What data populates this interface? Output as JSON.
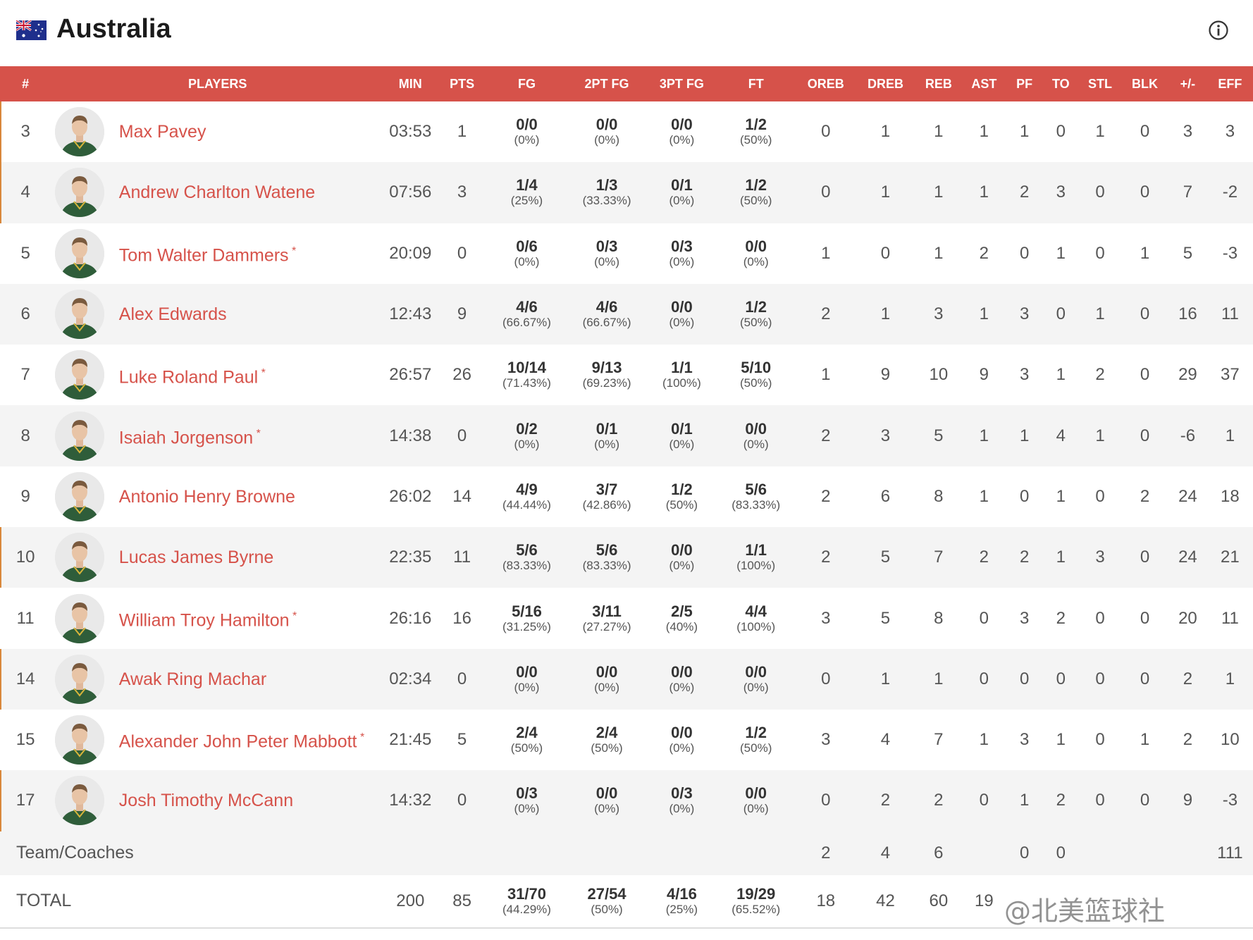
{
  "team": {
    "name": "Australia"
  },
  "columns": [
    "#",
    "PLAYERS",
    "MIN",
    "PTS",
    "FG",
    "2PT FG",
    "3PT FG",
    "FT",
    "OREB",
    "DREB",
    "REB",
    "AST",
    "PF",
    "TO",
    "STL",
    "BLK",
    "+/-",
    "EFF"
  ],
  "players": [
    {
      "no": "3",
      "name": "Max Pavey",
      "starter": false,
      "min": "03:53",
      "pts": "1",
      "fg": "0/0",
      "fg_pct": "(0%)",
      "fg2": "0/0",
      "fg2_pct": "(0%)",
      "fg3": "0/0",
      "fg3_pct": "(0%)",
      "ft": "1/2",
      "ft_pct": "(50%)",
      "oreb": "0",
      "dreb": "1",
      "reb": "1",
      "ast": "1",
      "pf": "1",
      "to": "0",
      "stl": "1",
      "blk": "0",
      "pm": "3",
      "eff": "3"
    },
    {
      "no": "4",
      "name": "Andrew Charlton Watene",
      "starter": false,
      "min": "07:56",
      "pts": "3",
      "fg": "1/4",
      "fg_pct": "(25%)",
      "fg2": "1/3",
      "fg2_pct": "(33.33%)",
      "fg3": "0/1",
      "fg3_pct": "(0%)",
      "ft": "1/2",
      "ft_pct": "(50%)",
      "oreb": "0",
      "dreb": "1",
      "reb": "1",
      "ast": "1",
      "pf": "2",
      "to": "3",
      "stl": "0",
      "blk": "0",
      "pm": "7",
      "eff": "-2"
    },
    {
      "no": "5",
      "name": "Tom Walter Dammers",
      "starter": true,
      "min": "20:09",
      "pts": "0",
      "fg": "0/6",
      "fg_pct": "(0%)",
      "fg2": "0/3",
      "fg2_pct": "(0%)",
      "fg3": "0/3",
      "fg3_pct": "(0%)",
      "ft": "0/0",
      "ft_pct": "(0%)",
      "oreb": "1",
      "dreb": "0",
      "reb": "1",
      "ast": "2",
      "pf": "0",
      "to": "1",
      "stl": "0",
      "blk": "1",
      "pm": "5",
      "eff": "-3"
    },
    {
      "no": "6",
      "name": "Alex Edwards",
      "starter": false,
      "min": "12:43",
      "pts": "9",
      "fg": "4/6",
      "fg_pct": "(66.67%)",
      "fg2": "4/6",
      "fg2_pct": "(66.67%)",
      "fg3": "0/0",
      "fg3_pct": "(0%)",
      "ft": "1/2",
      "ft_pct": "(50%)",
      "oreb": "2",
      "dreb": "1",
      "reb": "3",
      "ast": "1",
      "pf": "3",
      "to": "0",
      "stl": "1",
      "blk": "0",
      "pm": "16",
      "eff": "11"
    },
    {
      "no": "7",
      "name": "Luke Roland Paul",
      "starter": true,
      "min": "26:57",
      "pts": "26",
      "fg": "10/14",
      "fg_pct": "(71.43%)",
      "fg2": "9/13",
      "fg2_pct": "(69.23%)",
      "fg3": "1/1",
      "fg3_pct": "(100%)",
      "ft": "5/10",
      "ft_pct": "(50%)",
      "oreb": "1",
      "dreb": "9",
      "reb": "10",
      "ast": "9",
      "pf": "3",
      "to": "1",
      "stl": "2",
      "blk": "0",
      "pm": "29",
      "eff": "37"
    },
    {
      "no": "8",
      "name": "Isaiah Jorgenson",
      "starter": true,
      "min": "14:38",
      "pts": "0",
      "fg": "0/2",
      "fg_pct": "(0%)",
      "fg2": "0/1",
      "fg2_pct": "(0%)",
      "fg3": "0/1",
      "fg3_pct": "(0%)",
      "ft": "0/0",
      "ft_pct": "(0%)",
      "oreb": "2",
      "dreb": "3",
      "reb": "5",
      "ast": "1",
      "pf": "1",
      "to": "4",
      "stl": "1",
      "blk": "0",
      "pm": "-6",
      "eff": "1"
    },
    {
      "no": "9",
      "name": "Antonio Henry Browne",
      "starter": false,
      "min": "26:02",
      "pts": "14",
      "fg": "4/9",
      "fg_pct": "(44.44%)",
      "fg2": "3/7",
      "fg2_pct": "(42.86%)",
      "fg3": "1/2",
      "fg3_pct": "(50%)",
      "ft": "5/6",
      "ft_pct": "(83.33%)",
      "oreb": "2",
      "dreb": "6",
      "reb": "8",
      "ast": "1",
      "pf": "0",
      "to": "1",
      "stl": "0",
      "blk": "2",
      "pm": "24",
      "eff": "18"
    },
    {
      "no": "10",
      "name": "Lucas James Byrne",
      "starter": false,
      "min": "22:35",
      "pts": "11",
      "fg": "5/6",
      "fg_pct": "(83.33%)",
      "fg2": "5/6",
      "fg2_pct": "(83.33%)",
      "fg3": "0/0",
      "fg3_pct": "(0%)",
      "ft": "1/1",
      "ft_pct": "(100%)",
      "oreb": "2",
      "dreb": "5",
      "reb": "7",
      "ast": "2",
      "pf": "2",
      "to": "1",
      "stl": "3",
      "blk": "0",
      "pm": "24",
      "eff": "21"
    },
    {
      "no": "11",
      "name": "William Troy Hamilton",
      "starter": true,
      "min": "26:16",
      "pts": "16",
      "fg": "5/16",
      "fg_pct": "(31.25%)",
      "fg2": "3/11",
      "fg2_pct": "(27.27%)",
      "fg3": "2/5",
      "fg3_pct": "(40%)",
      "ft": "4/4",
      "ft_pct": "(100%)",
      "oreb": "3",
      "dreb": "5",
      "reb": "8",
      "ast": "0",
      "pf": "3",
      "to": "2",
      "stl": "0",
      "blk": "0",
      "pm": "20",
      "eff": "11"
    },
    {
      "no": "14",
      "name": "Awak Ring Machar",
      "starter": false,
      "min": "02:34",
      "pts": "0",
      "fg": "0/0",
      "fg_pct": "(0%)",
      "fg2": "0/0",
      "fg2_pct": "(0%)",
      "fg3": "0/0",
      "fg3_pct": "(0%)",
      "ft": "0/0",
      "ft_pct": "(0%)",
      "oreb": "0",
      "dreb": "1",
      "reb": "1",
      "ast": "0",
      "pf": "0",
      "to": "0",
      "stl": "0",
      "blk": "0",
      "pm": "2",
      "eff": "1"
    },
    {
      "no": "15",
      "name": "Alexander John Peter Mabbott",
      "starter": true,
      "min": "21:45",
      "pts": "5",
      "fg": "2/4",
      "fg_pct": "(50%)",
      "fg2": "2/4",
      "fg2_pct": "(50%)",
      "fg3": "0/0",
      "fg3_pct": "(0%)",
      "ft": "1/2",
      "ft_pct": "(50%)",
      "oreb": "3",
      "dreb": "4",
      "reb": "7",
      "ast": "1",
      "pf": "3",
      "to": "1",
      "stl": "0",
      "blk": "1",
      "pm": "2",
      "eff": "10"
    },
    {
      "no": "17",
      "name": "Josh Timothy McCann",
      "starter": false,
      "min": "14:32",
      "pts": "0",
      "fg": "0/3",
      "fg_pct": "(0%)",
      "fg2": "0/0",
      "fg2_pct": "(0%)",
      "fg3": "0/3",
      "fg3_pct": "(0%)",
      "ft": "0/0",
      "ft_pct": "(0%)",
      "oreb": "0",
      "dreb": "2",
      "reb": "2",
      "ast": "0",
      "pf": "1",
      "to": "2",
      "stl": "0",
      "blk": "0",
      "pm": "9",
      "eff": "-3"
    }
  ],
  "team_coaches": {
    "label": "Team/Coaches",
    "oreb": "2",
    "dreb": "4",
    "reb": "6",
    "pf": "0",
    "to": "0",
    "eff": "111"
  },
  "totals": {
    "label": "TOTAL",
    "min": "200",
    "pts": "85",
    "fg": "31/70",
    "fg_pct": "(44.29%)",
    "fg2": "27/54",
    "fg2_pct": "(50%)",
    "fg3": "4/16",
    "fg3_pct": "(25%)",
    "ft": "19/29",
    "ft_pct": "(65.52%)",
    "oreb": "18",
    "dreb": "42",
    "reb": "60",
    "ast": "19"
  },
  "watermark": "@北美篮球社",
  "colors": {
    "header_bg": "#d6524a",
    "player_link": "#d6524a",
    "row_alt": "#f4f4f4",
    "jersey": "#2f5d3a"
  }
}
